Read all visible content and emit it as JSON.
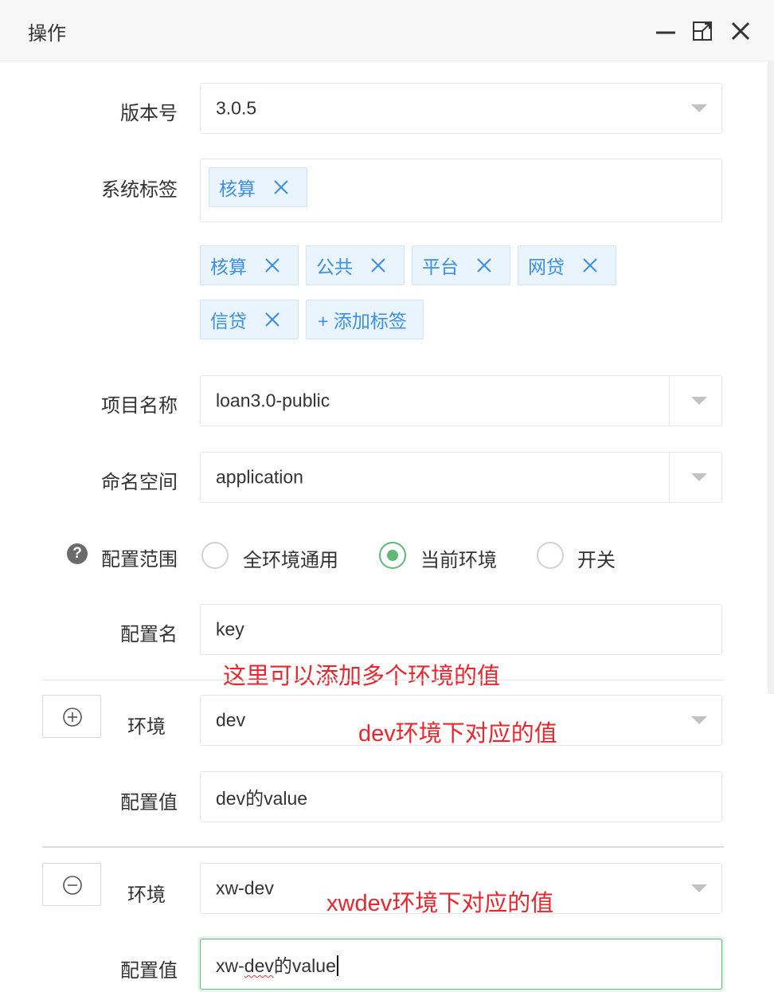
{
  "window": {
    "title": "操作"
  },
  "form": {
    "version": {
      "label": "版本号",
      "value": "3.0.5"
    },
    "system_tags": {
      "label": "系统标签",
      "selected": [
        "核算"
      ],
      "options": [
        "核算",
        "公共",
        "平台",
        "网贷",
        "信贷"
      ],
      "add_label": "+ 添加标签"
    },
    "project": {
      "label": "项目名称",
      "value": "loan3.0-public"
    },
    "namespace": {
      "label": "命名空间",
      "value": "application"
    },
    "scope": {
      "label": "配置范围",
      "options": [
        "全环境通用",
        "当前环境",
        "开关"
      ],
      "selected": "当前环境"
    },
    "config_name": {
      "label": "配置名",
      "value": "key"
    },
    "env_rows": [
      {
        "env_label": "环境",
        "env_value": "dev",
        "value_label": "配置值",
        "value": "dev的value"
      },
      {
        "env_label": "环境",
        "env_value": "xw-dev",
        "value_label": "配置值",
        "value_prefix": "xw-",
        "value_misspelled": "dev",
        "value_suffix": "的value"
      }
    ]
  },
  "annotations": {
    "multi_env": "这里可以添加多个环境的值",
    "dev_note": "dev环境下对应的值",
    "xwdev_note": "xwdev环境下对应的值"
  },
  "colors": {
    "accent_green": "#5fb878",
    "tag_blue": "#3a8ee6",
    "annotation_red": "#e8262d"
  }
}
